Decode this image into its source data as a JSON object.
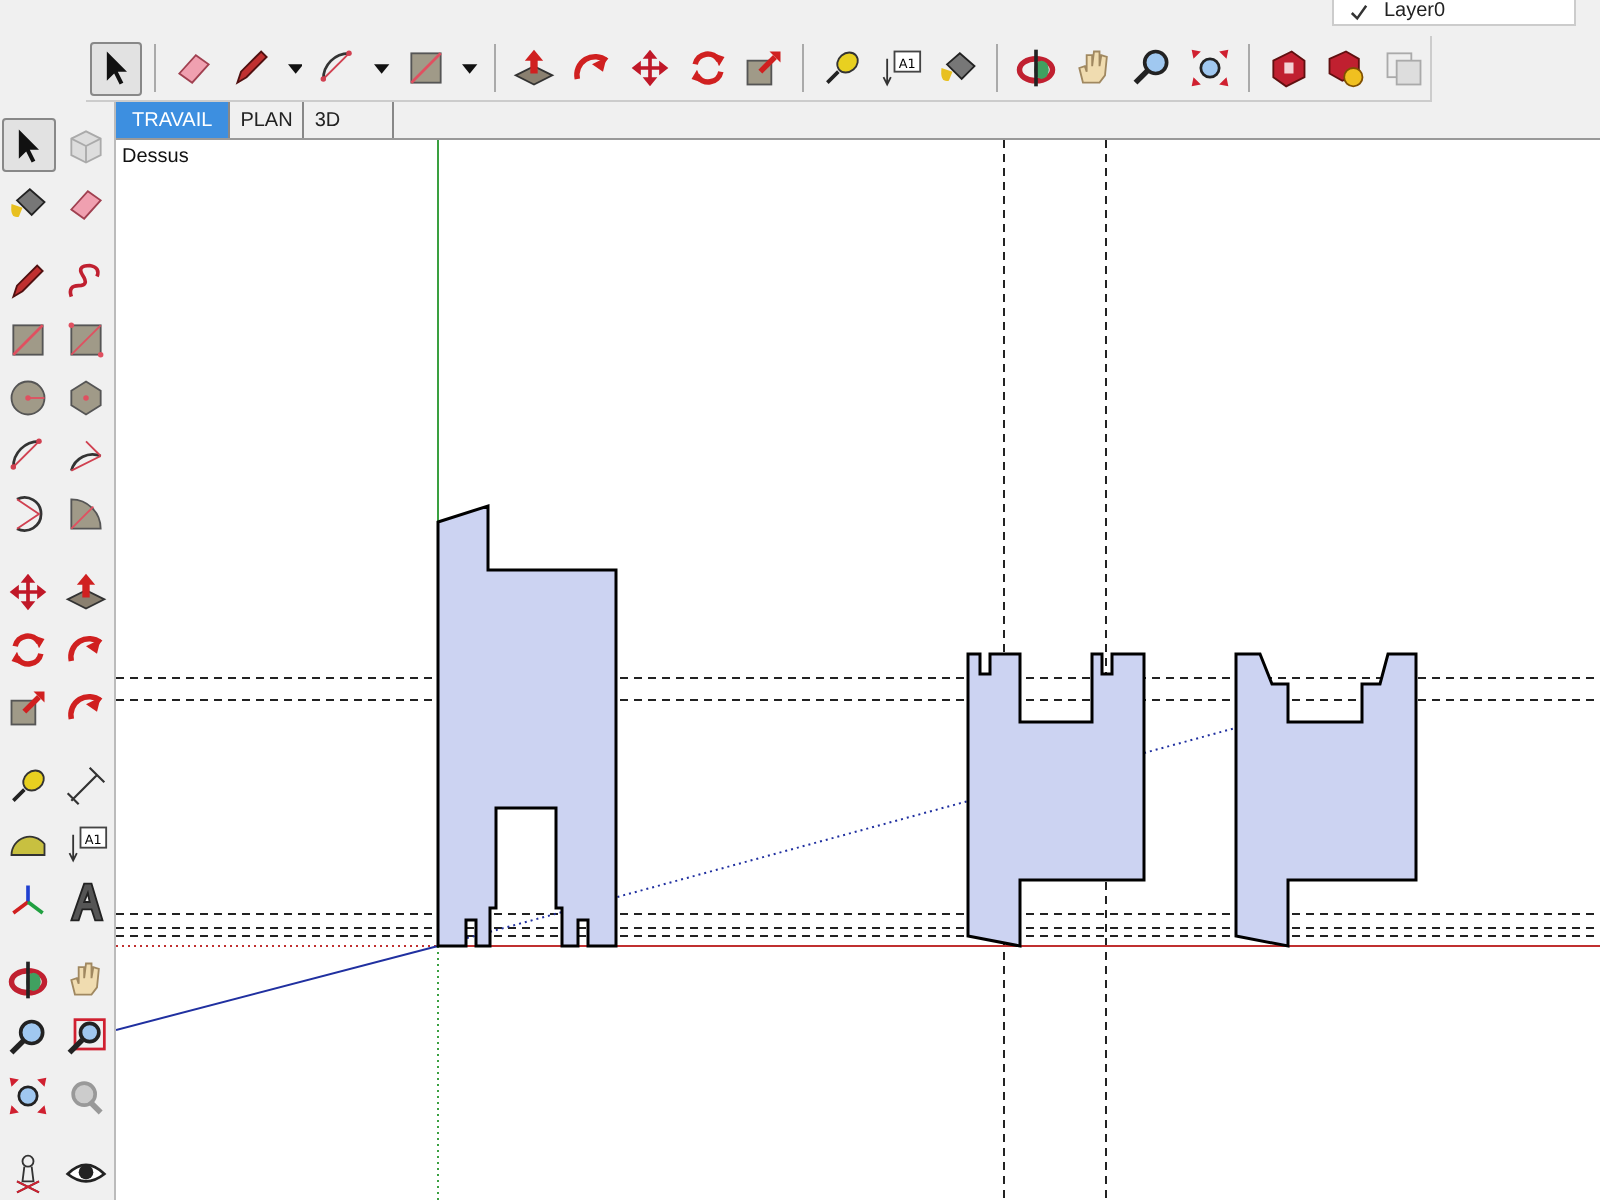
{
  "layer_dropdown": {
    "layer": "Layer0",
    "checked": true
  },
  "toolbar": {
    "select_pressed": true,
    "text_icon_label": "A1"
  },
  "scene_tabs": [
    {
      "label": "TRAVAIL",
      "selected": true
    },
    {
      "label": "PLAN",
      "selected": false
    },
    {
      "label": "3D",
      "selected": false
    }
  ],
  "side_toolbar": {
    "select_pressed": true,
    "text_icon_label": "A1"
  },
  "viewport": {
    "view_label": "Dessus"
  }
}
